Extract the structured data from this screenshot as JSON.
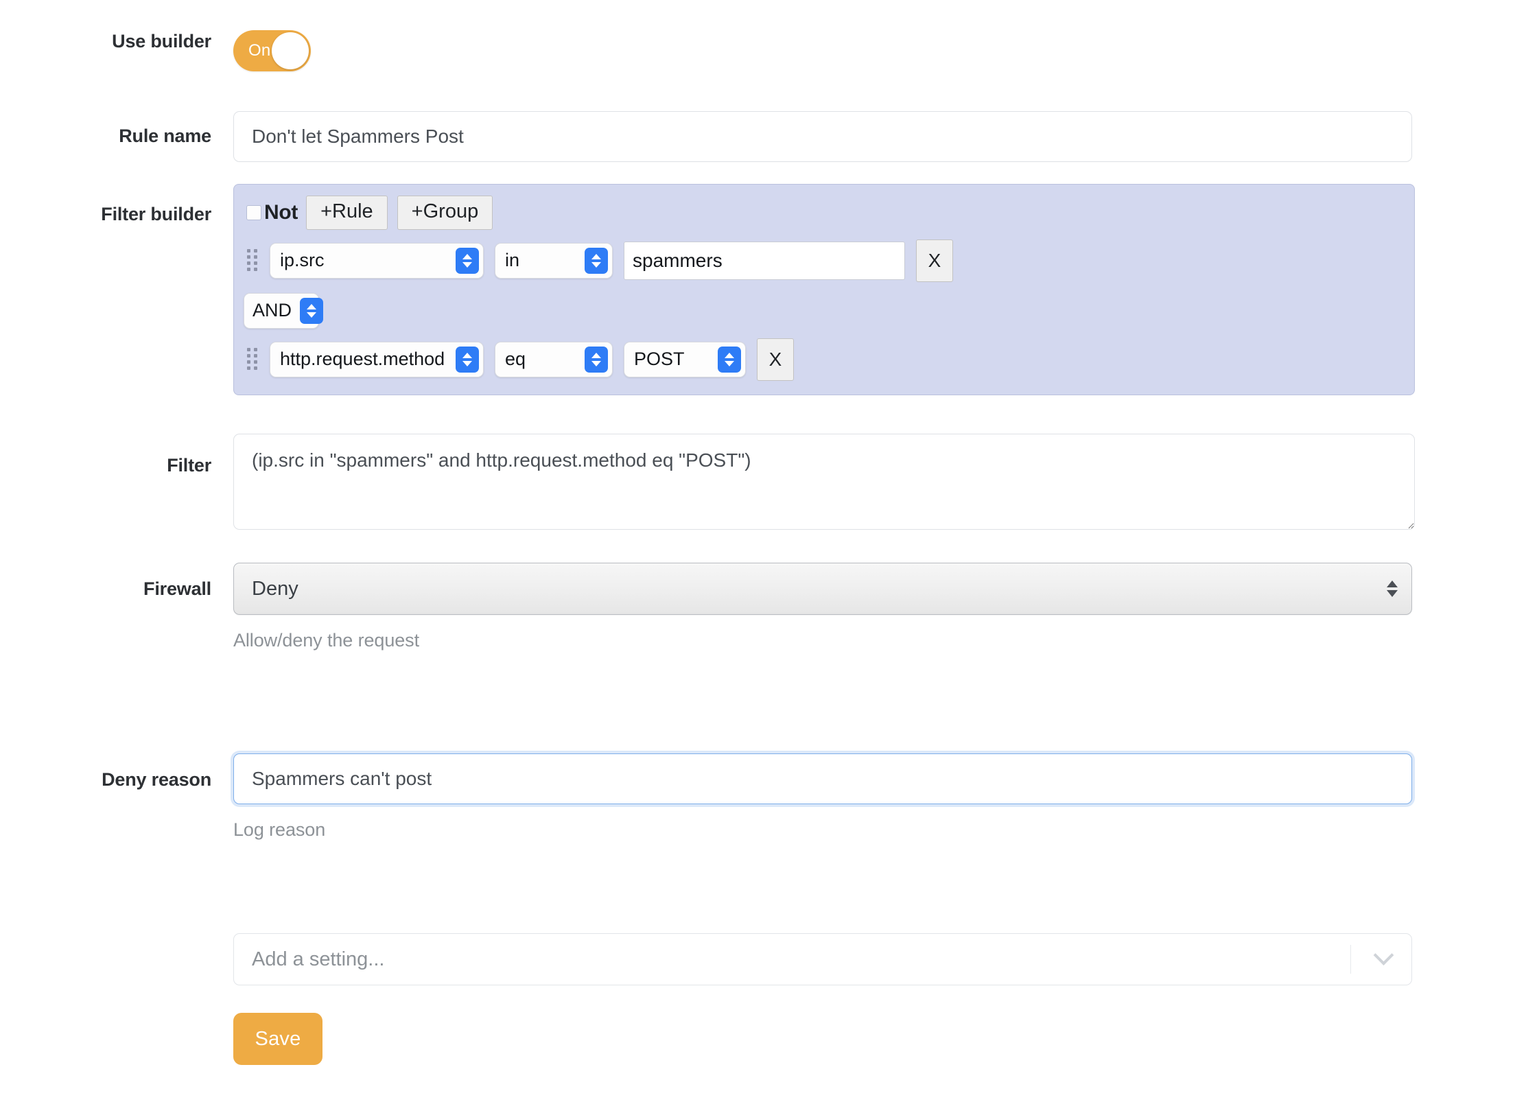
{
  "form": {
    "use_builder": {
      "label": "Use builder",
      "toggle_state": "On",
      "accent_color": "#eeab44"
    },
    "rule_name": {
      "label": "Rule name",
      "value": "Don't let Spammers Post"
    },
    "filter_builder": {
      "label": "Filter builder",
      "panel_color": "#d3d8ef",
      "not_label": "Not",
      "not_checked": "false",
      "add_rule_label": "+Rule",
      "add_group_label": "+Group",
      "rules": [
        {
          "field": "ip.src",
          "operator": "in",
          "value": "spammers",
          "remove_label": "X",
          "value_kind": "text"
        },
        {
          "field": "http.request.method",
          "operator": "eq",
          "value": "POST",
          "remove_label": "X",
          "value_kind": "select"
        }
      ],
      "connector": "AND"
    },
    "filter": {
      "label": "Filter",
      "value": "(ip.src in \"spammers\" and http.request.method eq \"POST\")"
    },
    "firewall": {
      "label": "Firewall",
      "value": "Deny",
      "help": "Allow/deny the request"
    },
    "deny_reason": {
      "label": "Deny reason",
      "value": "Spammers can't post",
      "help": "Log reason",
      "focused": "true"
    },
    "add_setting": {
      "placeholder": "Add a setting...",
      "chevron_icon": "chevron-down-icon"
    },
    "save": {
      "label": "Save"
    }
  }
}
